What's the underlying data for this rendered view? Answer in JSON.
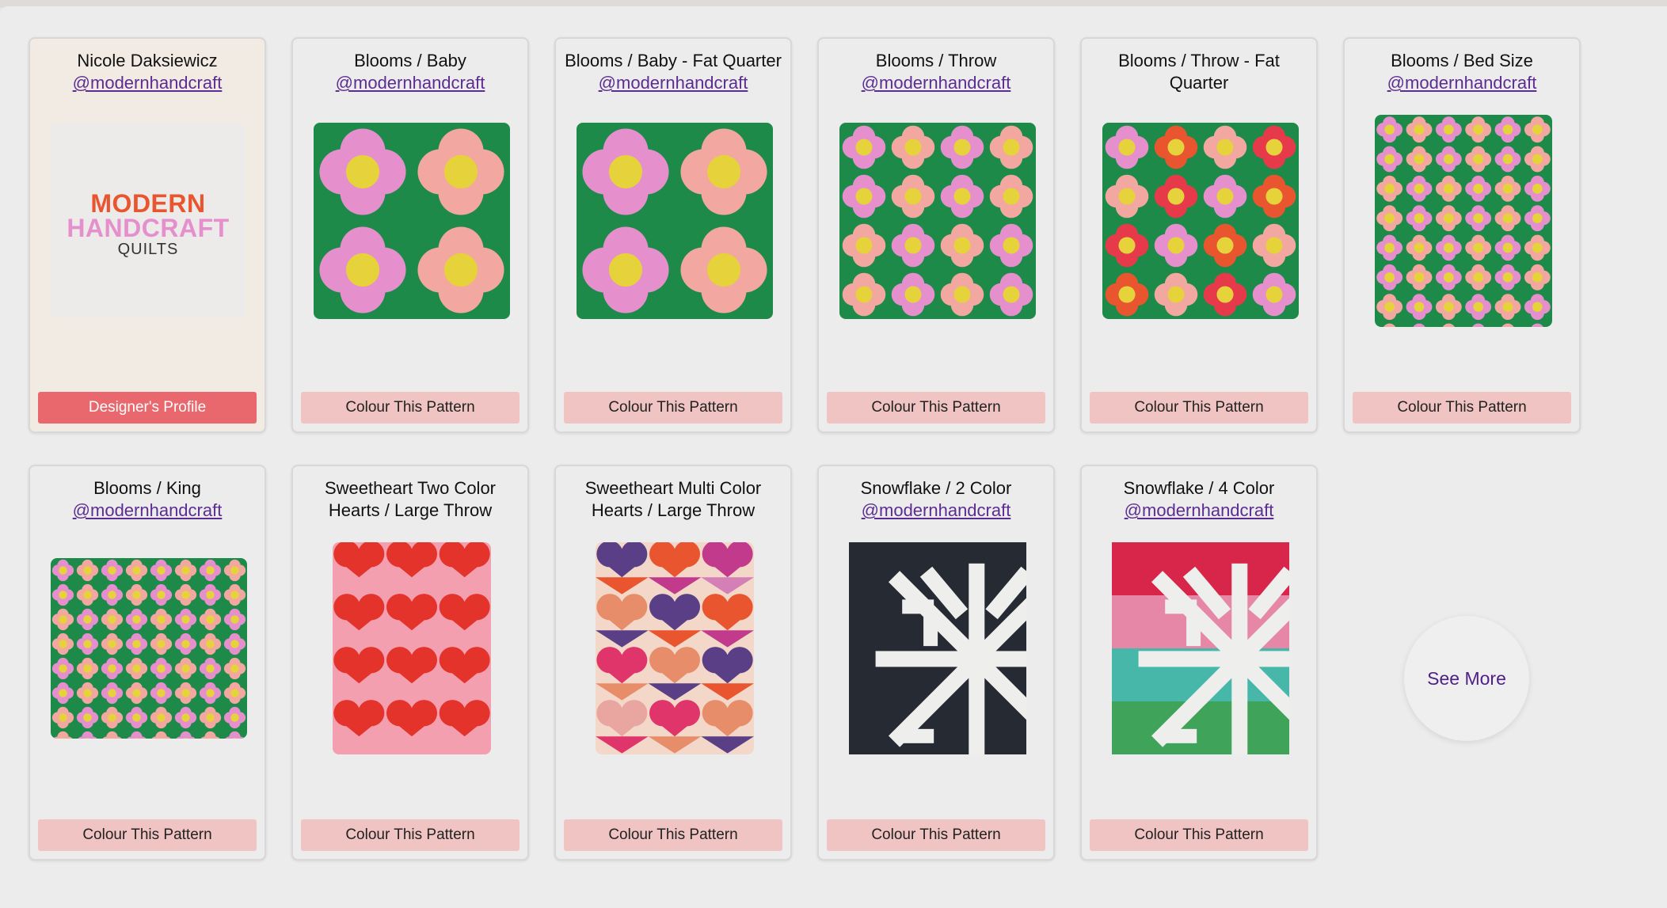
{
  "designer": {
    "name": "Nicole Daksiewicz",
    "handle": "@modernhandcraft",
    "logo": {
      "line1": "MODERN",
      "line2": "HANDCRAFT",
      "line3": "QUILTS"
    },
    "button_label": "Designer's Profile"
  },
  "patterns": [
    {
      "title": "Blooms / Baby",
      "handle": "@modernhandcraft",
      "button_label": "Colour This Pattern"
    },
    {
      "title": "Blooms / Baby - Fat Quarter",
      "handle": "@modernhandcraft",
      "button_label": "Colour This Pattern"
    },
    {
      "title": "Blooms / Throw",
      "handle": "@modernhandcraft",
      "button_label": "Colour This Pattern"
    },
    {
      "title": "Blooms / Throw - Fat Quarter",
      "handle": "",
      "button_label": "Colour This Pattern"
    },
    {
      "title": "Blooms / Bed Size",
      "handle": "@modernhandcraft",
      "button_label": "Colour This Pattern"
    },
    {
      "title": "Blooms / King",
      "handle": "@modernhandcraft",
      "button_label": "Colour This Pattern"
    },
    {
      "title": "Sweetheart Two Color Hearts / Large Throw",
      "handle": "",
      "button_label": "Colour This Pattern"
    },
    {
      "title": "Sweetheart Multi Color Hearts / Large Throw",
      "handle": "",
      "button_label": "Colour This Pattern"
    },
    {
      "title": "Snowflake / 2 Color",
      "handle": "@modernhandcraft",
      "button_label": "Colour This Pattern"
    },
    {
      "title": "Snowflake / 4 Color",
      "handle": "@modernhandcraft",
      "button_label": "Colour This Pattern"
    }
  ],
  "see_more_label": "See More",
  "colors": {
    "designer_button": "#e8686d",
    "pattern_button": "#f0c4c2",
    "handle_link": "#5c2d91",
    "blooms_green": "#1e8a4a",
    "blooms_pink": "#e58fcd",
    "blooms_orange": "#e8552e",
    "blooms_yellow": "#e6d23a",
    "heart_red": "#e3332b",
    "heart_pink": "#f39fb0",
    "snow_navy": "#262a33",
    "snow_red": "#d8264a",
    "snow_pink": "#e687a8",
    "snow_teal": "#47b7aa",
    "snow_green": "#3fa35a",
    "snow_white": "#eeeeec"
  }
}
